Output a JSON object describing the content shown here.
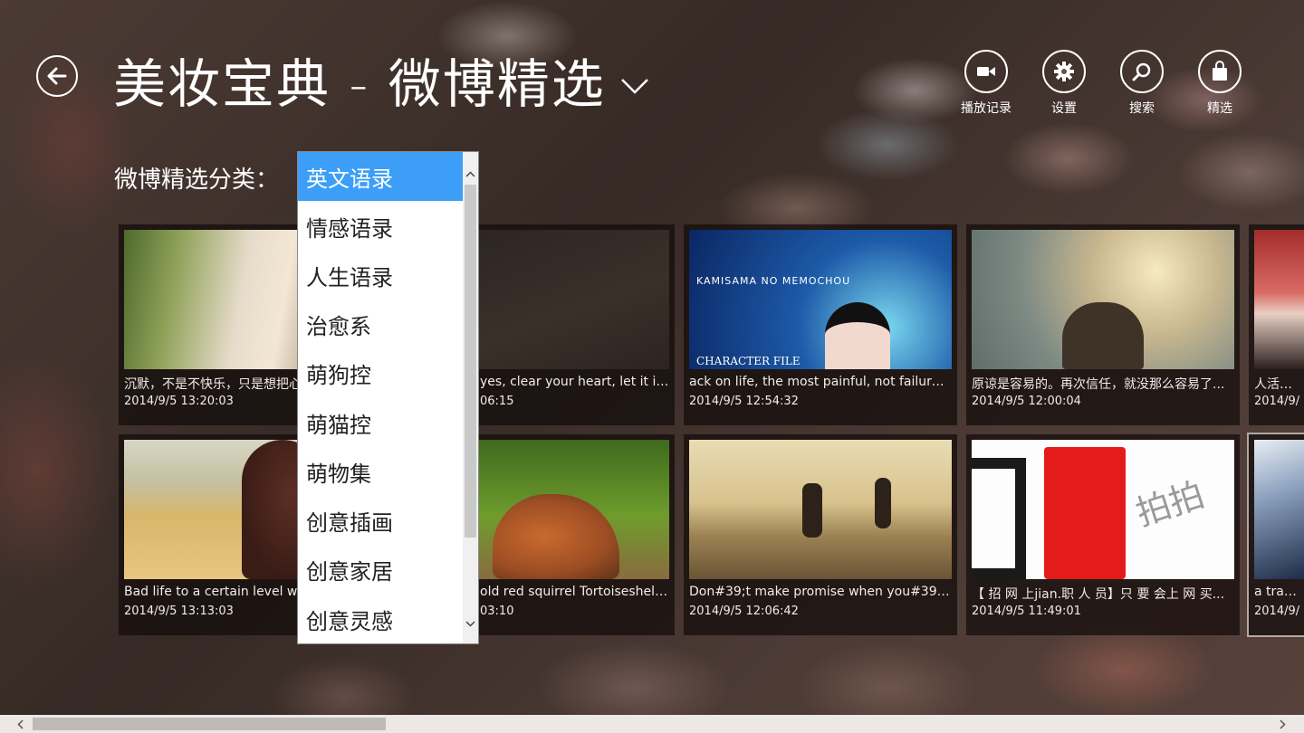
{
  "header": {
    "title": "美妆宝典 - 微博精选"
  },
  "appbar": {
    "buttons": [
      {
        "label": "播放记录",
        "icon": "video-camera-icon"
      },
      {
        "label": "设置",
        "icon": "gear-icon"
      },
      {
        "label": "搜索",
        "icon": "search-icon"
      },
      {
        "label": "精选",
        "icon": "shopping-bag-icon"
      }
    ]
  },
  "category": {
    "label": "微博精选分类：",
    "selected": "英文语录",
    "options": [
      "英文语录",
      "情感语录",
      "人生语录",
      "治愈系",
      "萌狗控",
      "萌猫控",
      "萌物集",
      "创意插画",
      "创意家居",
      "创意灵感"
    ]
  },
  "tiles": [
    {
      "caption": "沉默，不是不快乐，只是想把心",
      "date": "2014/9/5 13:20:03"
    },
    {
      "caption": "yes, clear your heart, let it in t...",
      "date": "06:15"
    },
    {
      "caption": "ack on life, the most painful, not failure, b...",
      "date": "2014/9/5 12:54:32"
    },
    {
      "caption": "原谅是容易的。再次信任，就没那么容易了...",
      "date": "2014/9/5 12:00:04"
    },
    {
      "caption": "人活一张",
      "date": "2014/9/"
    },
    {
      "caption": "Bad life to a certain level will",
      "date": "2014/9/5 13:13:03"
    },
    {
      "caption": "old red squirrel Tortoiseshell a...",
      "date": "03:10"
    },
    {
      "caption": "Don#39;t make promise when you#39;re i...",
      "date": "2014/9/5 12:06:42"
    },
    {
      "caption": "【 招 网 上jian.职 人 员】只 要 会上 网 买...",
      "date": "2014/9/5 11:49:01"
    },
    {
      "caption": "a travele",
      "date": "2014/9/"
    }
  ],
  "tile_images": {
    "sticker_text": "拍拍",
    "anime_title": "KAMISAMA NO MEMOCHOU",
    "anime_sub": "CHARACTER FILE"
  },
  "colors": {
    "selection_blue": "#3c9ef7",
    "tile_bg": "#140e0c"
  }
}
